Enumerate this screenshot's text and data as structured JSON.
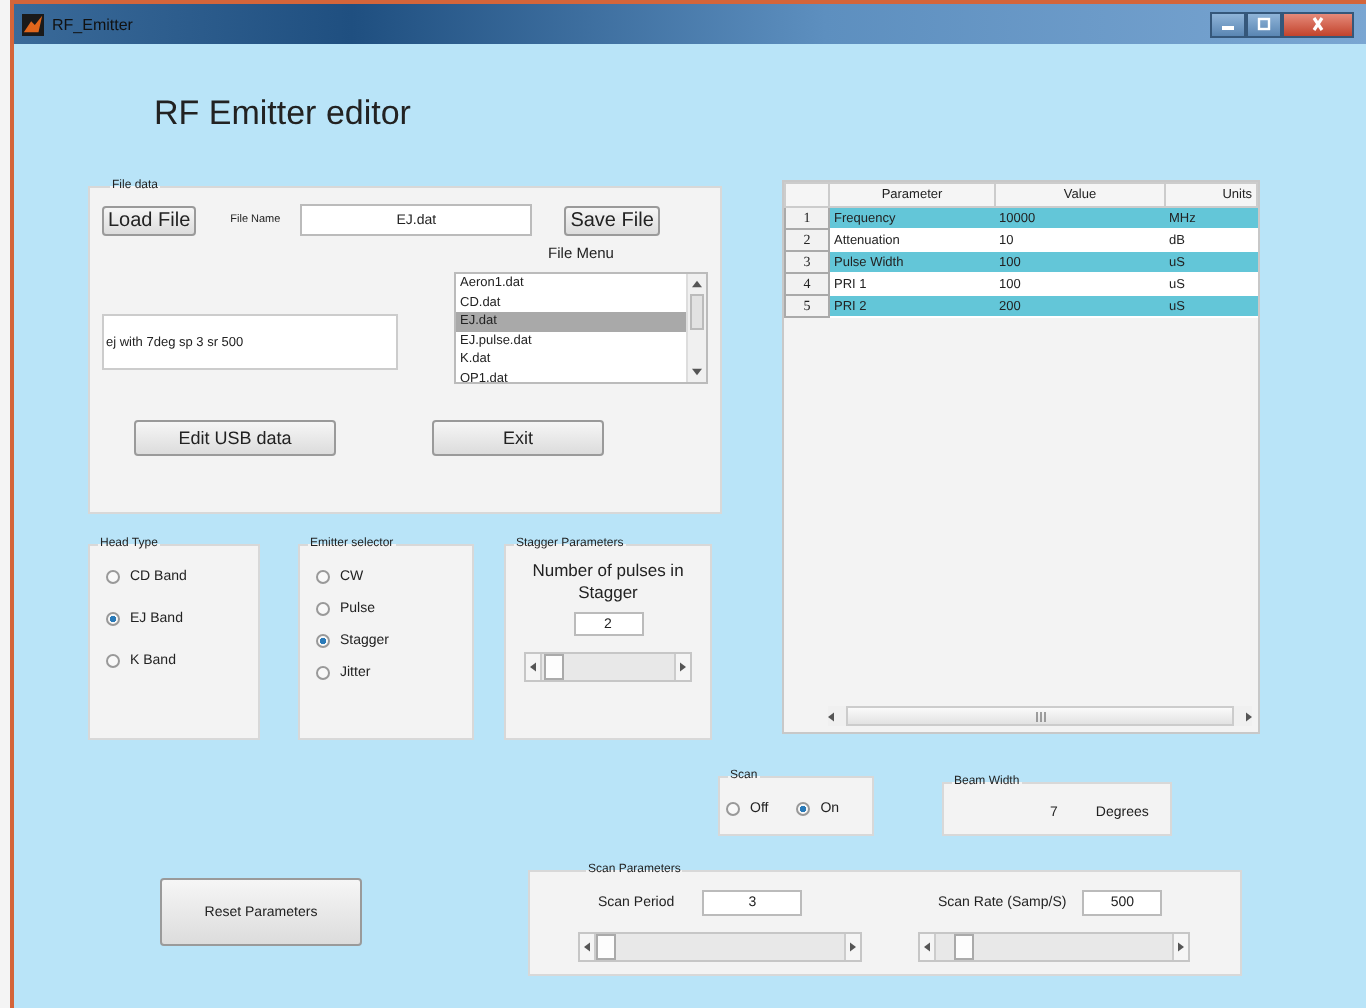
{
  "window": {
    "title": "RF_Emitter"
  },
  "heading": "RF Emitter editor",
  "file_data": {
    "title": "File data",
    "load_button": "Load File",
    "file_name_label": "File Name",
    "file_name_value": "EJ.dat",
    "save_button": "Save File",
    "file_menu_label": "File Menu",
    "file_menu_items": [
      {
        "label": "Aeron1.dat",
        "selected": false
      },
      {
        "label": "CD.dat",
        "selected": false
      },
      {
        "label": "EJ.dat",
        "selected": true
      },
      {
        "label": "EJ.pulse.dat",
        "selected": false
      },
      {
        "label": "K.dat",
        "selected": false
      },
      {
        "label": "OP1.dat",
        "selected": false
      }
    ],
    "description": "ej with 7deg sp 3 sr 500",
    "edit_usb_button": "Edit USB data",
    "exit_button": "Exit"
  },
  "table": {
    "columns": [
      "Parameter",
      "Value",
      "Units"
    ],
    "rows": [
      {
        "index": "1",
        "parameter": "Frequency",
        "value": "10000",
        "units": "MHz"
      },
      {
        "index": "2",
        "parameter": "Attenuation",
        "value": "10",
        "units": "dB"
      },
      {
        "index": "3",
        "parameter": "Pulse Width",
        "value": "100",
        "units": "uS"
      },
      {
        "index": "4",
        "parameter": "PRI 1",
        "value": "100",
        "units": "uS"
      },
      {
        "index": "5",
        "parameter": "PRI 2",
        "value": "200",
        "units": "uS"
      }
    ]
  },
  "head_type": {
    "title": "Head Type",
    "options": [
      {
        "label": "CD Band",
        "selected": false
      },
      {
        "label": "EJ Band",
        "selected": true
      },
      {
        "label": "K Band",
        "selected": false
      }
    ]
  },
  "emitter_selector": {
    "title": "Emitter selector",
    "options": [
      {
        "label": "CW",
        "selected": false
      },
      {
        "label": "Pulse",
        "selected": false
      },
      {
        "label": "Stagger",
        "selected": true
      },
      {
        "label": "Jitter",
        "selected": false
      }
    ]
  },
  "stagger": {
    "title": "Stagger Parameters",
    "label": "Number of pulses in Stagger",
    "value": "2",
    "slider": {
      "level": 0.02
    }
  },
  "scan": {
    "title": "Scan",
    "options": [
      {
        "label": "Off",
        "selected": false
      },
      {
        "label": "On",
        "selected": true
      }
    ]
  },
  "beam_width": {
    "title": "Beam Width",
    "value": "7",
    "unit": "Degrees"
  },
  "reset_button": "Reset Parameters",
  "scan_parameters": {
    "title": "Scan Parameters",
    "period_label": "Scan Period",
    "period_value": "3",
    "period_slider": {
      "level": 0.0
    },
    "rate_label": "Scan Rate (Samp/S)",
    "rate_value": "500",
    "rate_slider": {
      "level": 0.08
    }
  }
}
